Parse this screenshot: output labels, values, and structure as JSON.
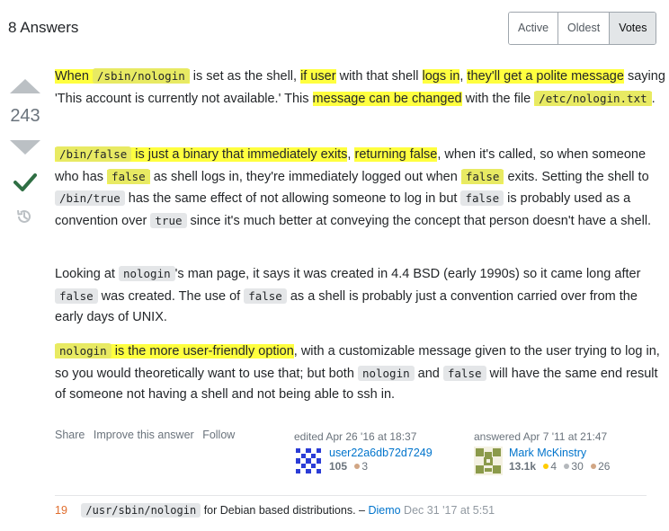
{
  "header": {
    "title": "8 Answers",
    "sort_tabs": [
      "Active",
      "Oldest",
      "Votes"
    ],
    "active_tab": "Votes"
  },
  "vote": {
    "count": "243"
  },
  "answer": {
    "p1": [
      {
        "t": "When ",
        "hl": true
      },
      {
        "t": "/sbin/nologin",
        "code": true,
        "hl": true
      },
      {
        "t": " is set as the shell, "
      },
      {
        "t": "if user",
        "hl": true
      },
      {
        "t": " with that shell "
      },
      {
        "t": "logs in",
        "hl": true
      },
      {
        "t": ", "
      },
      {
        "t": "they'll get a polite message",
        "hl": true
      },
      {
        "t": " saying 'This account is currently not available.' This "
      },
      {
        "t": "message can be changed",
        "hl": true
      },
      {
        "t": " with the file "
      },
      {
        "t": "/etc/nologin.txt",
        "code": true,
        "hl": true
      },
      {
        "t": "."
      }
    ],
    "p2": [
      {
        "t": "/bin/false",
        "code": true,
        "hl": true
      },
      {
        "t": " is just a binary that immediately exits",
        "hl": true
      },
      {
        "t": ", "
      },
      {
        "t": "returning false",
        "hl": true
      },
      {
        "t": ", when it's called, so when someone who has "
      },
      {
        "t": "false",
        "code": true,
        "hl": true
      },
      {
        "t": " as shell logs in, they're immediately logged out when "
      },
      {
        "t": "false",
        "code": true,
        "hl": true
      },
      {
        "t": " exits. Setting the shell to "
      },
      {
        "t": "/bin/true",
        "code": true
      },
      {
        "t": " has the same effect of not allowing someone to log in but "
      },
      {
        "t": "false",
        "code": true
      },
      {
        "t": " is probably used as a convention over "
      },
      {
        "t": "true",
        "code": true
      },
      {
        "t": " since it's much better at conveying the concept that person doesn't have a shell."
      }
    ],
    "p3": [
      {
        "t": "Looking at "
      },
      {
        "t": "nologin",
        "code": true
      },
      {
        "t": "'s man page, it says it was created in 4.4 BSD (early 1990s) so it came long after "
      },
      {
        "t": "false",
        "code": true
      },
      {
        "t": " was created. The use of "
      },
      {
        "t": "false",
        "code": true
      },
      {
        "t": " as a shell is probably just a convention carried over from the early days of UNIX."
      }
    ],
    "p4": [
      {
        "t": "nologin",
        "code": true,
        "hl": true
      },
      {
        "t": " is the more user-friendly option",
        "hl": true
      },
      {
        "t": ", with a customizable message given to the user trying to log in, so you would theoretically want to use that; but both "
      },
      {
        "t": "nologin",
        "code": true
      },
      {
        "t": " and "
      },
      {
        "t": "false",
        "code": true
      },
      {
        "t": " will have the same end result of someone not having a shell and not being able to ssh in."
      }
    ]
  },
  "post_menu": {
    "share": "Share",
    "improve": "Improve this answer",
    "follow": "Follow"
  },
  "edited": {
    "action": "edited Apr 26 '16 at 18:37",
    "user": "user22a6db72d7249",
    "rep": "105",
    "bronze": "3"
  },
  "answered": {
    "action": "answered Apr 7 '11 at 21:47",
    "user": "Mark McKinstry",
    "rep": "13.1k",
    "gold": "4",
    "silver": "30",
    "bronze": "26"
  },
  "comment": {
    "score": "19",
    "code": "/usr/sbin/nologin",
    "text": " for Debian based distributions. – ",
    "user": "Diemo",
    "date": " Dec 31 '17 at 5:51"
  },
  "colors": {
    "highlight": "#ffff3f",
    "link": "#0074cc",
    "accepted": "#2f6f44",
    "comment_score": "#e06d2d"
  }
}
